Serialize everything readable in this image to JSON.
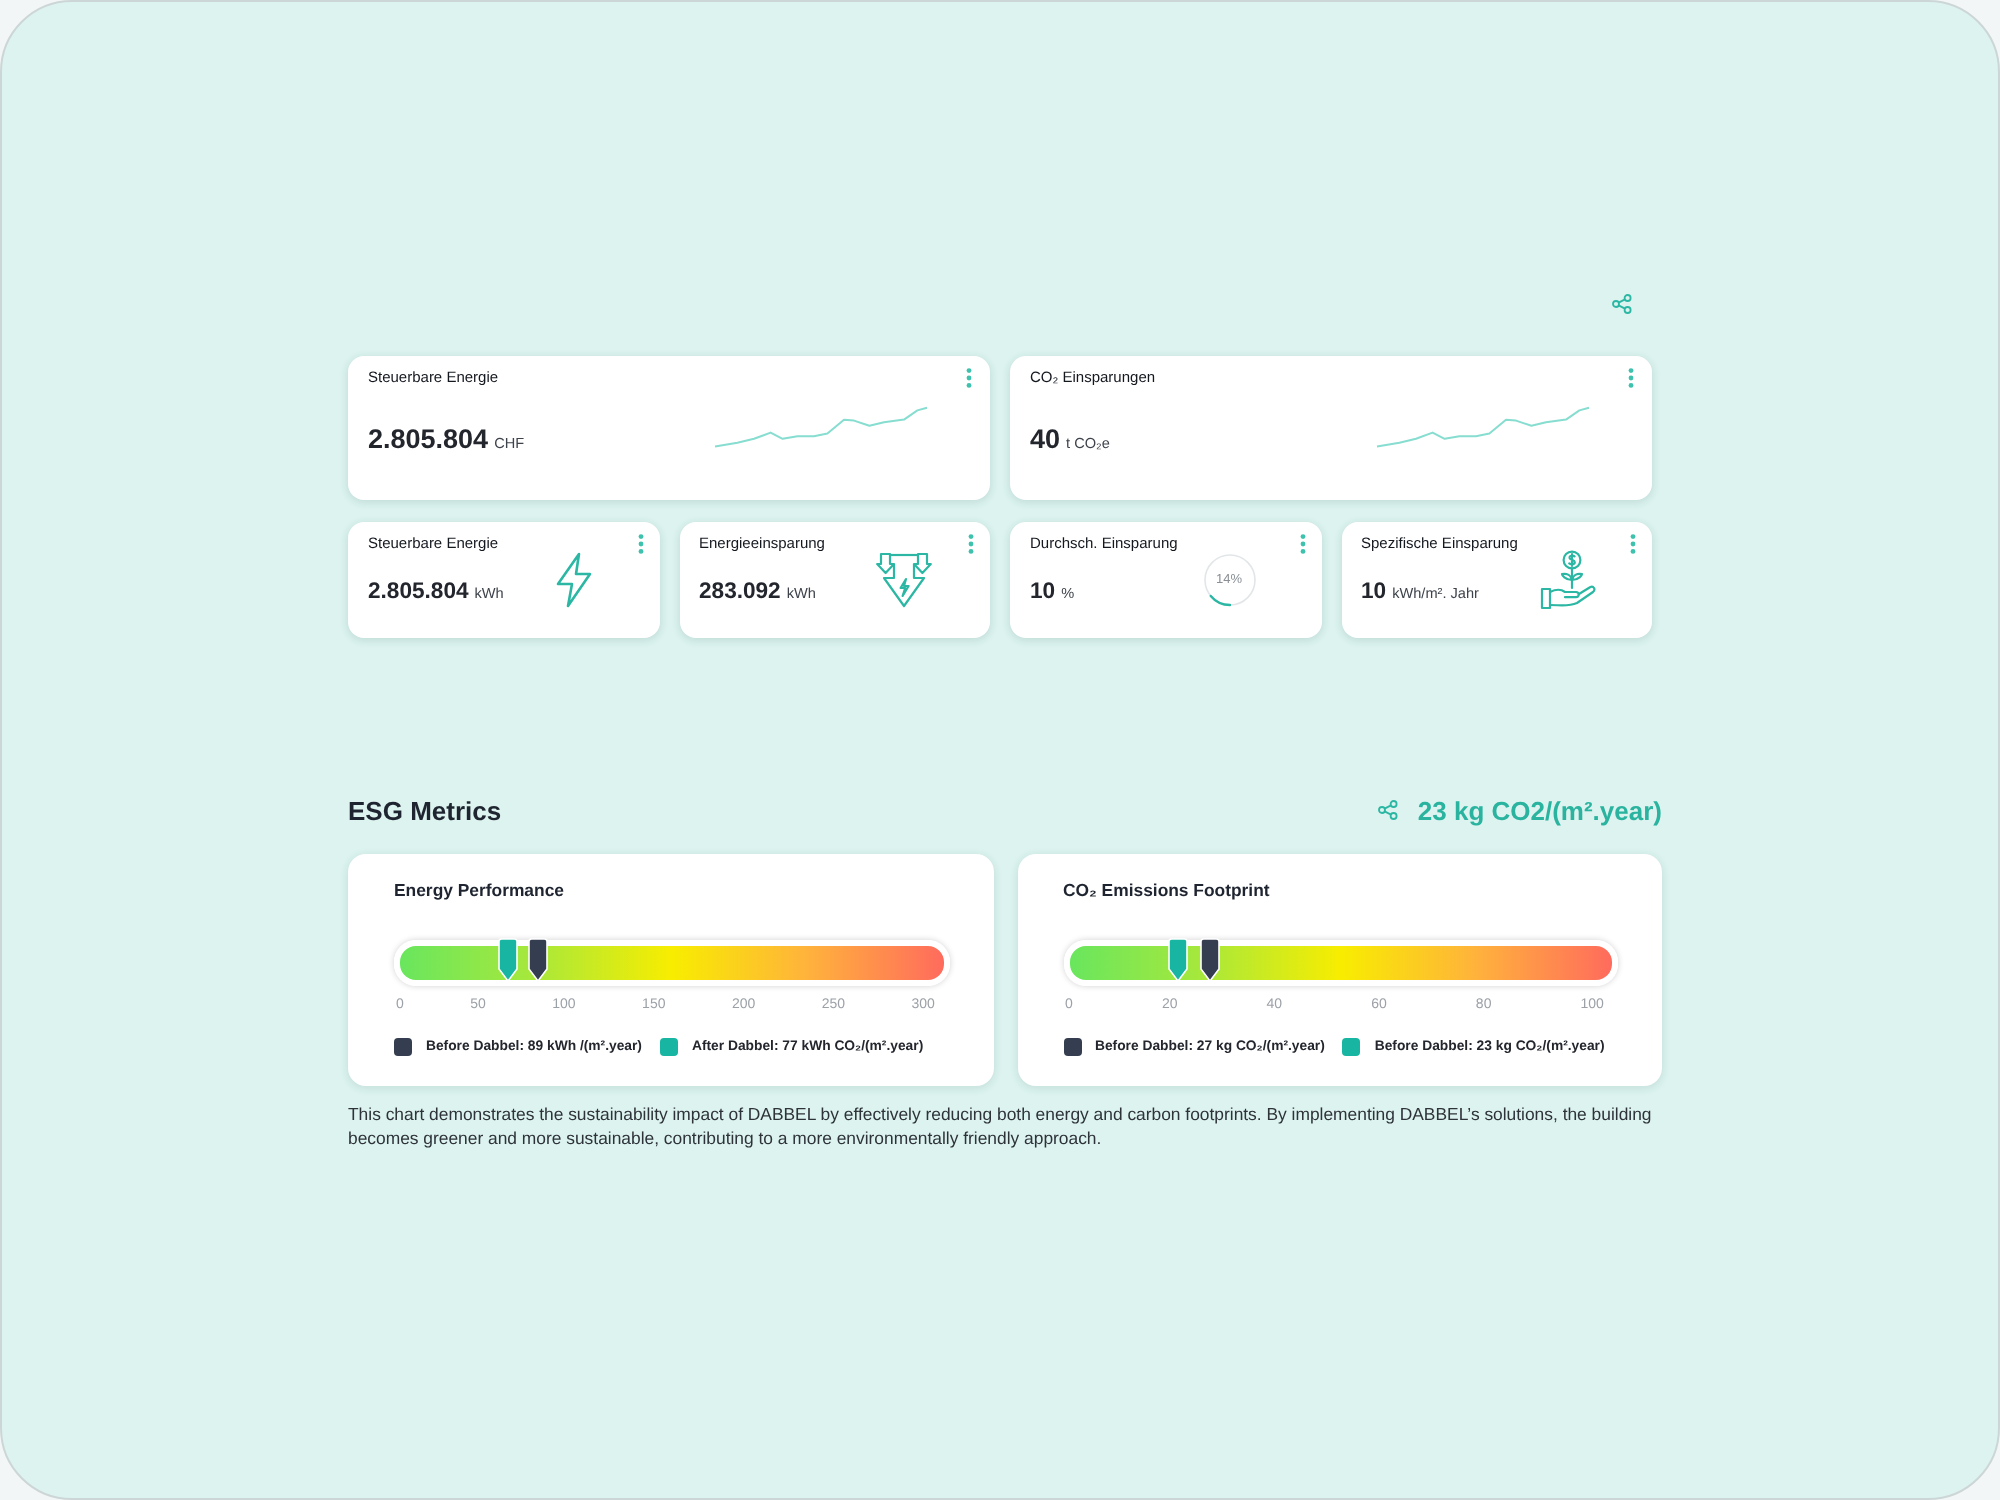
{
  "summary_cards": [
    {
      "title": "Steuerbare Energie",
      "value": "2.805.804",
      "unit": "CHF"
    },
    {
      "title": "CO₂ Einsparungen",
      "value": "40",
      "unit": "t CO₂e"
    }
  ],
  "stat_cards": [
    {
      "kind": "energy",
      "title": "Steuerbare Energie",
      "value": "2.805.804",
      "unit": "kWh"
    },
    {
      "kind": "savings",
      "title": "Energieeinsparung",
      "value": "283.092",
      "unit": "kWh"
    },
    {
      "kind": "ratio",
      "title": "Durchsch. Einsparung",
      "value": "10",
      "unit": "%",
      "ring_label": "14%",
      "level": 0.14
    },
    {
      "kind": "intensity",
      "title": "Spezifische Einsparung",
      "value": "10",
      "unit": "kWh/m². Jahr"
    }
  ],
  "esg": {
    "title": "ESG Metrics",
    "highlight": "23 kg CO2/(m².year)",
    "gauges": [
      {
        "title": "Energy Performance",
        "ticks": [
          "0",
          "50",
          "100",
          "150",
          "200",
          "250",
          "300"
        ],
        "pins": [
          {
            "level": 0.255,
            "color": "#343e50"
          },
          {
            "level": 0.2,
            "color": "#17b5a2"
          }
        ],
        "legend": [
          {
            "label": "Before Dabbel: 89 kWh /(m².year)",
            "color": "#343e50"
          },
          {
            "label": "After Dabbel: 77 kWh CO₂/(m².year)",
            "color": "#17b5a2"
          }
        ]
      },
      {
        "title": "CO₂ Emissions Footprint",
        "ticks": [
          "0",
          "20",
          "40",
          "60",
          "80",
          "100"
        ],
        "pins": [
          {
            "level": 0.26,
            "color": "#343e50"
          },
          {
            "level": 0.2,
            "color": "#17b5a2"
          }
        ],
        "legend": [
          {
            "label": "Before Dabbel: 27 kg CO₂/(m².year)",
            "color": "#343e50"
          },
          {
            "label": "Before Dabbel: 23 kg CO₂/(m².year)",
            "color": "#17b5a2"
          }
        ]
      }
    ],
    "description": "This chart demonstrates the sustainability impact of DABBEL by effectively reducing both energy and carbon footprints. By implementing DABBEL’s solutions, the building becomes greener and more sustainable, contributing to a more environmentally friendly approach."
  }
}
